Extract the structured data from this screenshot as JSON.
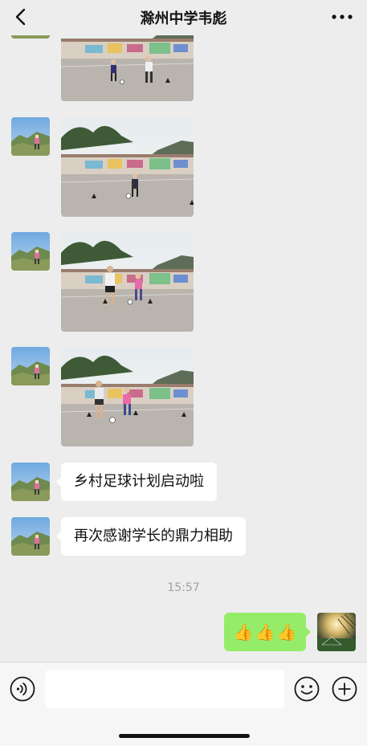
{
  "header": {
    "title": "滁州中学韦彪",
    "back_icon": "chevron-left-icon",
    "more_icon": "more-dots-icon"
  },
  "messages": [
    {
      "type": "image",
      "from": "other",
      "content": "photo-kids-football-drill"
    },
    {
      "type": "image",
      "from": "other",
      "content": "photo-kid-dribbling-cones"
    },
    {
      "type": "image",
      "from": "other",
      "content": "photo-coach-and-kid"
    },
    {
      "type": "image",
      "from": "other",
      "content": "photo-coach-and-kid-ball"
    },
    {
      "type": "text",
      "from": "other",
      "text": "乡村足球计划启动啦"
    },
    {
      "type": "text",
      "from": "other",
      "text": "再次感谢学长的鼎力相助"
    },
    {
      "type": "timestamp",
      "text": "15:57"
    },
    {
      "type": "emoji",
      "from": "self",
      "content": [
        "👍",
        "👍",
        "👍"
      ]
    }
  ],
  "input": {
    "placeholder": "",
    "voice_icon": "voice-icon",
    "emoji_icon": "emoji-icon",
    "plus_icon": "plus-icon"
  },
  "colors": {
    "background": "#ededed",
    "self_bubble": "#95ec69",
    "other_bubble": "#ffffff",
    "timestamp": "#a0a0a0"
  }
}
